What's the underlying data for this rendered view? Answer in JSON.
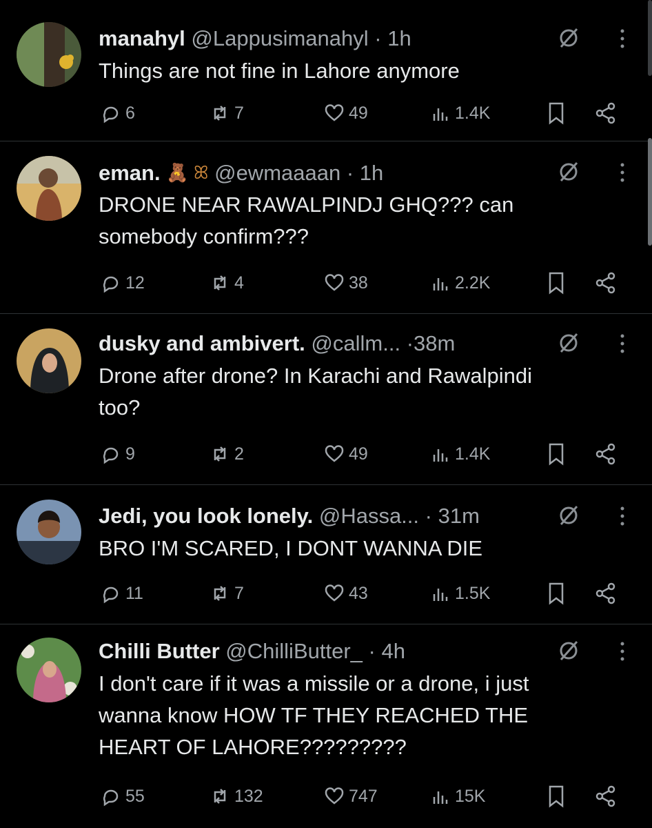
{
  "tweets": [
    {
      "name": "manahyl",
      "emoji": "",
      "handle": "@Lappusimanahyl",
      "time": "· 1h",
      "text": [
        "Things are not fine in Lahore anymore"
      ],
      "replies": "6",
      "reposts": "7",
      "likes": "49",
      "views": "1.4K",
      "avatar_icon": "avatar-tree-bird"
    },
    {
      "name": "eman.",
      "emoji": "🧸 ꕤ",
      "handle": "@ewmaaaan",
      "time": "· 1h",
      "text": [
        "DRONE NEAR RAWALPINDJ GHQ??? can",
        "somebody confirm???"
      ],
      "replies": "12",
      "reposts": "4",
      "likes": "38",
      "views": "2.2K",
      "avatar_icon": "avatar-girl-field"
    },
    {
      "name": "dusky and ambivert.",
      "emoji": "",
      "handle": "@callm...",
      "time": "·38m",
      "text": [
        "Drone after drone? In Karachi and Rawalpindi",
        "too?"
      ],
      "replies": "9",
      "reposts": "2",
      "likes": "49",
      "views": "1.4K",
      "avatar_icon": "avatar-hijab"
    },
    {
      "name": "Jedi, you look lonely.",
      "emoji": "",
      "handle": "@Hassa...",
      "time": "· 31m",
      "text": [
        "BRO I'M SCARED, I DONT WANNA DIE"
      ],
      "replies": "11",
      "reposts": "7",
      "likes": "43",
      "views": "1.5K",
      "avatar_icon": "avatar-man"
    },
    {
      "name": "Chilli Butter",
      "emoji": "",
      "handle": "@ChilliButter_",
      "time": "· 4h",
      "text": [
        "I don't care if it was a missile or a drone, i just",
        "wanna know HOW TF THEY REACHED THE",
        "HEART OF LAHORE?????????"
      ],
      "replies": "55",
      "reposts": "132",
      "likes": "747",
      "views": "15K",
      "avatar_icon": "avatar-flowers"
    }
  ],
  "colors": {
    "background": "#000000",
    "text": "#e7e9ea",
    "muted": "#a1a6ab",
    "divider": "#2f3336"
  }
}
